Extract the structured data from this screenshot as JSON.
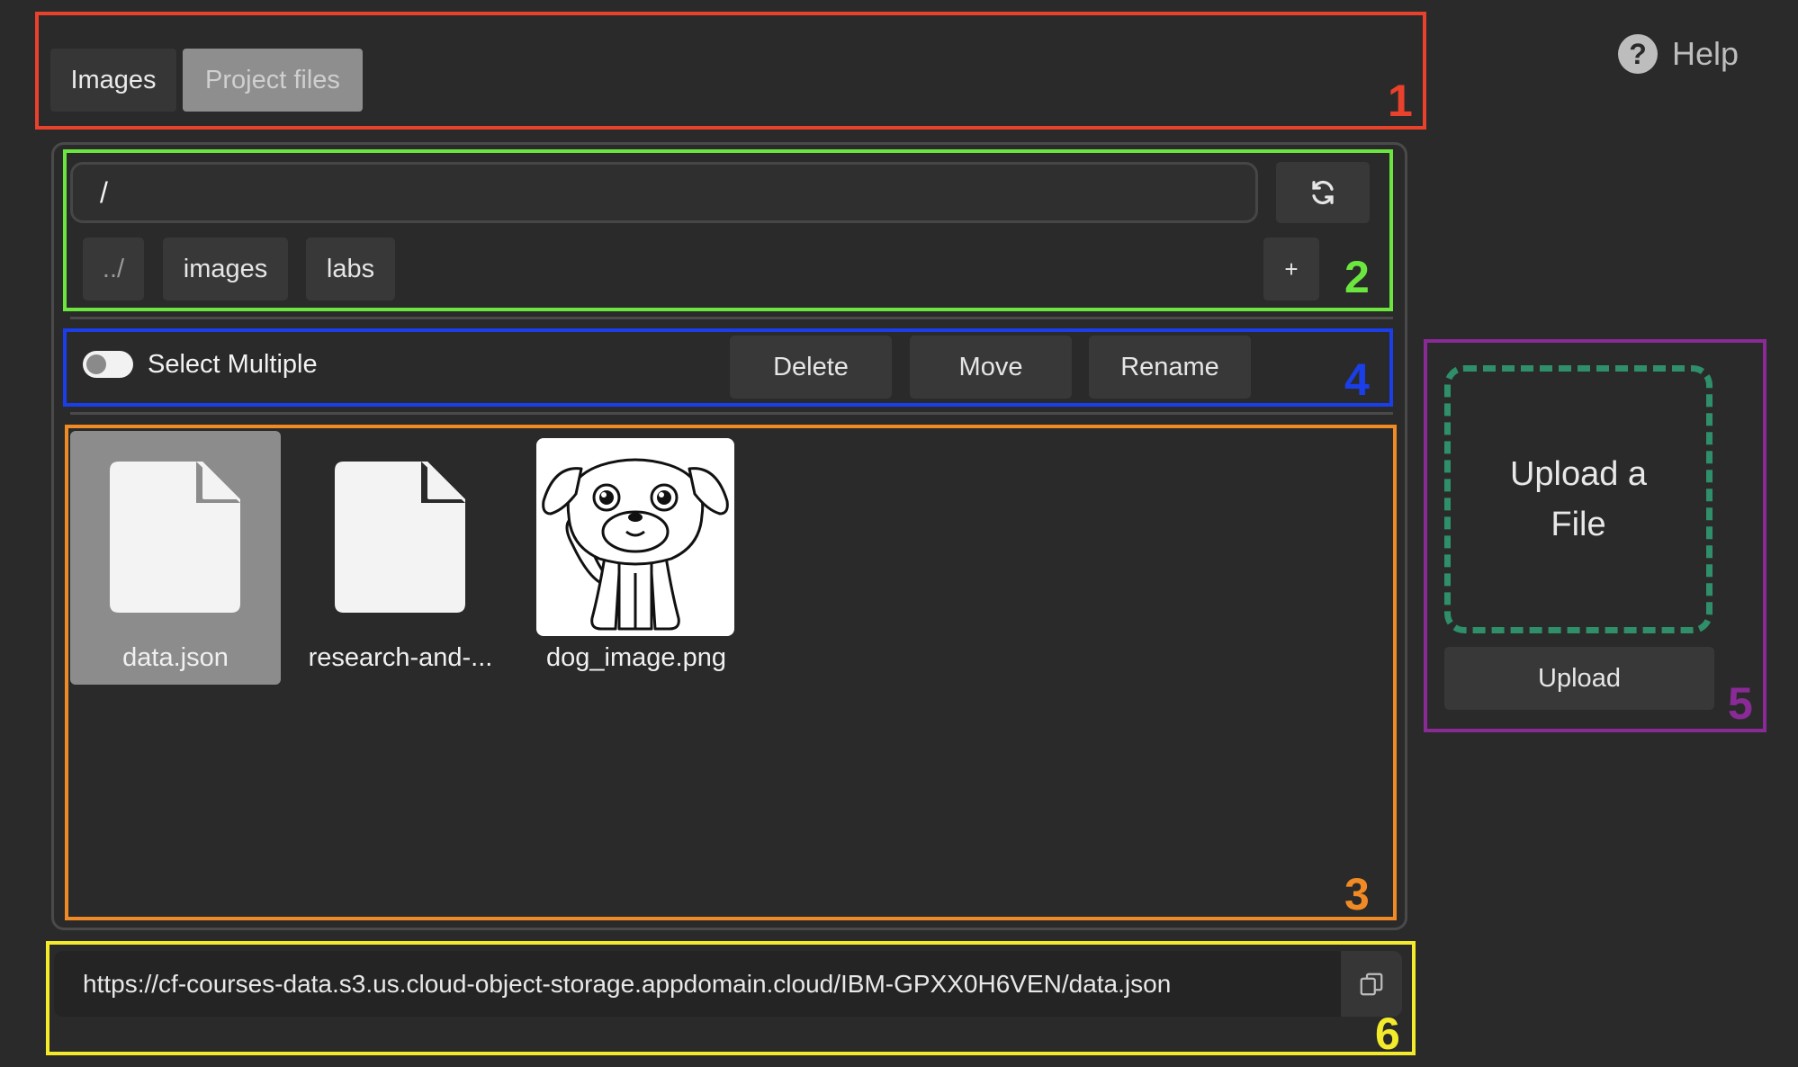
{
  "tabs": [
    {
      "label": "Images",
      "active": true
    },
    {
      "label": "Project files",
      "active": false
    }
  ],
  "help": {
    "label": "Help",
    "icon": "question-circle-icon"
  },
  "path_bar": {
    "value": "/",
    "refresh_icon": "refresh-icon"
  },
  "folders": [
    "../",
    "images",
    "labs"
  ],
  "new_folder": {
    "label": "+"
  },
  "toolbar": {
    "select_multiple": "Select Multiple",
    "toggle_on": false,
    "delete": "Delete",
    "move": "Move",
    "rename": "Rename"
  },
  "files": [
    {
      "name": "data.json",
      "icon": "file-icon",
      "selected": true
    },
    {
      "name": "research-and-...",
      "icon": "file-icon",
      "selected": false
    },
    {
      "name": "dog_image.png",
      "icon": "dog-image-thumbnail",
      "selected": false
    }
  ],
  "upload": {
    "drop_label_line1": "Upload a",
    "drop_label_line2": "File",
    "button": "Upload"
  },
  "url_bar": {
    "value": "https://cf-courses-data.s3.us.cloud-object-storage.appdomain.cloud/IBM-GPXX0H6VEN/data.json",
    "copy_icon": "copy-icon"
  },
  "annotations": [
    {
      "number": "1",
      "color": "#e8412c"
    },
    {
      "number": "2",
      "color": "#6be63f"
    },
    {
      "number": "3",
      "color": "#f08a24"
    },
    {
      "number": "4",
      "color": "#1a3ee8"
    },
    {
      "number": "5",
      "color": "#8a2a96"
    },
    {
      "number": "6",
      "color": "#f2ea2a"
    }
  ],
  "colors": {
    "background": "#2a2a2a",
    "panel_border": "#4a4a4a",
    "button": "#383838",
    "selected_tile": "#8c8c8c",
    "upload_dash": "#2f8f6a"
  }
}
